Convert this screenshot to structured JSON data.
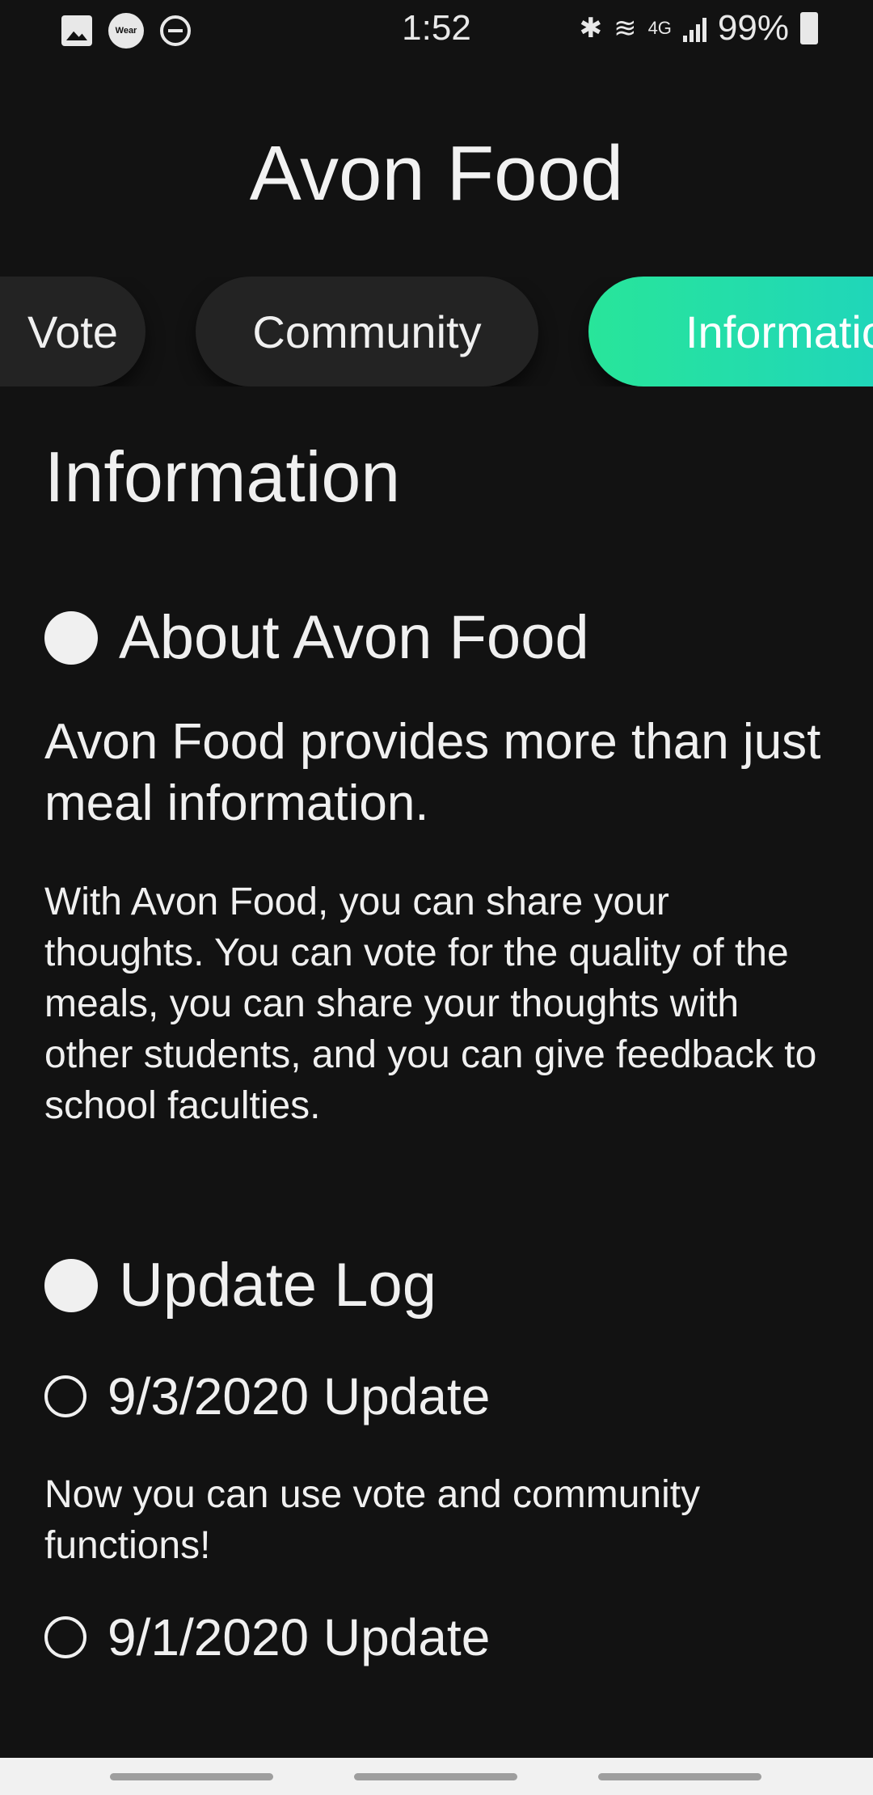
{
  "status_bar": {
    "time": "1:52",
    "battery": "99%",
    "left_icons": [
      "gallery-icon",
      "wear-icon",
      "do-not-disturb-icon"
    ],
    "right_icons": [
      "bluetooth-icon",
      "wifi-icon",
      "lte-icon",
      "signal-icon",
      "battery-icon"
    ],
    "wear_label": "Wear",
    "lte_label": "4G"
  },
  "app": {
    "title": "Avon Food"
  },
  "tabs": [
    {
      "label": "Vote",
      "active": false
    },
    {
      "label": "Community",
      "active": false
    },
    {
      "label": "Information",
      "active": true
    }
  ],
  "colors": {
    "background": "#121212",
    "tab_inactive": "#232323",
    "tab_active_gradient_start": "#28e59a",
    "tab_active_gradient_end": "#1ccfc8",
    "text": "#f0f0f0"
  },
  "content": {
    "title": "Information",
    "about": {
      "heading": "About Avon Food",
      "lead": "Avon Food provides more than just meal information.",
      "body": "With Avon Food, you can share your thoughts. You can vote for the quality of the meals, you can share your thoughts with other students, and you can give feedback to school faculties."
    },
    "update_log": {
      "heading": "Update Log",
      "entries": [
        {
          "title": "9/3/2020 Update",
          "body": "Now you can use vote and community functions!"
        },
        {
          "title": "9/1/2020 Update",
          "body": ""
        }
      ]
    }
  }
}
